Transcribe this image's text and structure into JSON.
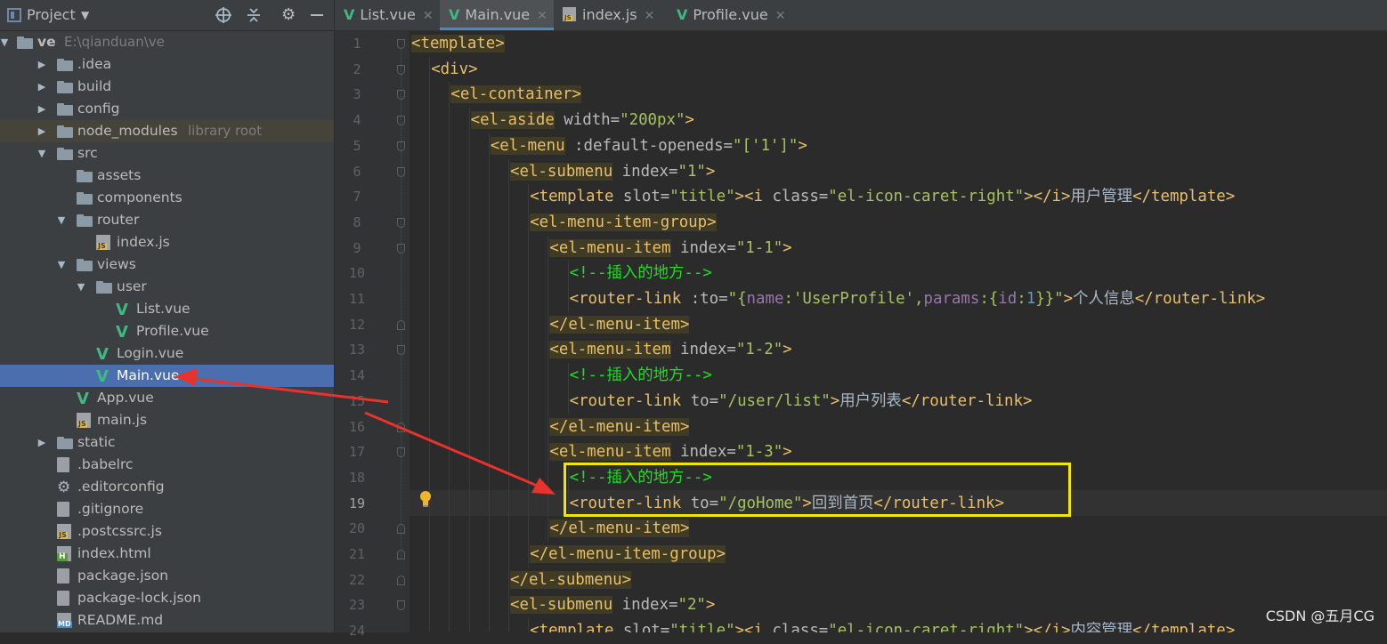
{
  "project_panel": {
    "title": "Project",
    "items": [
      {
        "label": "ve",
        "sub": "E:\\qianduan\\ve",
        "depth": 0,
        "arrow": "down",
        "icon": "project-folder-icon"
      },
      {
        "label": ".idea",
        "depth": 1,
        "arrow": "right",
        "icon": "folder-icon"
      },
      {
        "label": "build",
        "depth": 1,
        "arrow": "right",
        "icon": "folder-icon"
      },
      {
        "label": "config",
        "depth": 1,
        "arrow": "right",
        "icon": "folder-icon"
      },
      {
        "label": "node_modules",
        "sub": "library root",
        "depth": 1,
        "arrow": "right",
        "icon": "folder-icon",
        "state": "libroot"
      },
      {
        "label": "src",
        "depth": 1,
        "arrow": "down",
        "icon": "folder-icon"
      },
      {
        "label": "assets",
        "depth": 2,
        "arrow": "",
        "icon": "folder-icon"
      },
      {
        "label": "components",
        "depth": 2,
        "arrow": "",
        "icon": "folder-icon"
      },
      {
        "label": "router",
        "depth": 2,
        "arrow": "down",
        "icon": "folder-icon"
      },
      {
        "label": "index.js",
        "depth": 3,
        "arrow": "",
        "icon": "js-file-icon"
      },
      {
        "label": "views",
        "depth": 2,
        "arrow": "down",
        "icon": "folder-icon"
      },
      {
        "label": "user",
        "depth": 3,
        "arrow": "down",
        "icon": "folder-icon"
      },
      {
        "label": "List.vue",
        "depth": 4,
        "arrow": "",
        "icon": "vue-file-icon"
      },
      {
        "label": "Profile.vue",
        "depth": 4,
        "arrow": "",
        "icon": "vue-file-icon"
      },
      {
        "label": "Login.vue",
        "depth": 3,
        "arrow": "",
        "icon": "vue-file-icon"
      },
      {
        "label": "Main.vue",
        "depth": 3,
        "arrow": "",
        "icon": "vue-file-icon",
        "state": "selected"
      },
      {
        "label": "App.vue",
        "depth": 2,
        "arrow": "",
        "icon": "vue-file-icon"
      },
      {
        "label": "main.js",
        "depth": 2,
        "arrow": "",
        "icon": "js-file-icon"
      },
      {
        "label": "static",
        "depth": 1,
        "arrow": "right",
        "icon": "folder-icon"
      },
      {
        "label": ".babelrc",
        "depth": 1,
        "arrow": "",
        "icon": "config-file-icon"
      },
      {
        "label": ".editorconfig",
        "depth": 1,
        "arrow": "",
        "icon": "gear-icon"
      },
      {
        "label": ".gitignore",
        "depth": 1,
        "arrow": "",
        "icon": "config-file-icon"
      },
      {
        "label": ".postcssrc.js",
        "depth": 1,
        "arrow": "",
        "icon": "js-file-icon"
      },
      {
        "label": "index.html",
        "depth": 1,
        "arrow": "",
        "icon": "html-file-icon"
      },
      {
        "label": "package.json",
        "depth": 1,
        "arrow": "",
        "icon": "config-file-icon"
      },
      {
        "label": "package-lock.json",
        "depth": 1,
        "arrow": "",
        "icon": "config-file-icon"
      },
      {
        "label": "README.md",
        "depth": 1,
        "arrow": "",
        "icon": "md-file-icon"
      }
    ]
  },
  "tabs": [
    {
      "label": "List.vue",
      "icon": "vue-file-icon",
      "active": false
    },
    {
      "label": "Main.vue",
      "icon": "vue-file-icon",
      "active": true
    },
    {
      "label": "index.js",
      "icon": "js-file-icon",
      "active": false
    },
    {
      "label": "Profile.vue",
      "icon": "vue-file-icon",
      "active": false
    }
  ],
  "editor": {
    "current_line": 19,
    "lines": [
      {
        "n": "1",
        "indent": 0,
        "tokens": [
          [
            "tbg",
            "<template>"
          ]
        ]
      },
      {
        "n": "2",
        "indent": 1,
        "tokens": [
          [
            "t",
            "<div>"
          ]
        ]
      },
      {
        "n": "3",
        "indent": 2,
        "tokens": [
          [
            "tbg",
            "<el-container>"
          ]
        ]
      },
      {
        "n": "4",
        "indent": 3,
        "tokens": [
          [
            "tbg",
            "<el-aside"
          ],
          [
            "at",
            " width="
          ],
          [
            "v",
            "\"200px\""
          ],
          [
            "t",
            ">"
          ]
        ]
      },
      {
        "n": "5",
        "indent": 4,
        "tokens": [
          [
            "tbg",
            "<el-menu"
          ],
          [
            "at",
            " :default-openeds="
          ],
          [
            "v",
            "\"["
          ],
          [
            "v",
            "'1'"
          ],
          [
            "v",
            "]\""
          ],
          [
            "t",
            ">"
          ]
        ]
      },
      {
        "n": "6",
        "indent": 5,
        "tokens": [
          [
            "tbg",
            "<el-submenu"
          ],
          [
            "at",
            " index="
          ],
          [
            "v",
            "\"1\""
          ],
          [
            "t",
            ">"
          ]
        ]
      },
      {
        "n": "7",
        "indent": 6,
        "tokens": [
          [
            "t",
            "<template"
          ],
          [
            "at",
            " slot="
          ],
          [
            "v",
            "\"title\""
          ],
          [
            "t",
            "><i"
          ],
          [
            "at",
            " class="
          ],
          [
            "v",
            "\"el-icon-caret-right\""
          ],
          [
            "t",
            "></i>"
          ],
          [
            "tx",
            "用户管理"
          ],
          [
            "t",
            "</template>"
          ]
        ]
      },
      {
        "n": "8",
        "indent": 6,
        "tokens": [
          [
            "tbg",
            "<el-menu-item-group>"
          ]
        ]
      },
      {
        "n": "9",
        "indent": 7,
        "tokens": [
          [
            "tbg",
            "<el-menu-item"
          ],
          [
            "at",
            " index="
          ],
          [
            "v",
            "\"1-1\""
          ],
          [
            "t",
            ">"
          ]
        ]
      },
      {
        "n": "10",
        "indent": 8,
        "tokens": [
          [
            "cm",
            "<!--插入的地方-->"
          ]
        ]
      },
      {
        "n": "11",
        "indent": 8,
        "tokens": [
          [
            "t",
            "<router-link"
          ],
          [
            "at",
            " :to="
          ],
          [
            "v",
            "\"{"
          ],
          [
            "nm",
            "name"
          ],
          [
            "v",
            ":'UserProfile',"
          ],
          [
            "nm",
            "params"
          ],
          [
            "v",
            ":{"
          ],
          [
            "nm",
            "id"
          ],
          [
            "v",
            ":"
          ],
          [
            "nv",
            "1"
          ],
          [
            "v",
            "}}\""
          ],
          [
            "t",
            ">"
          ],
          [
            "tx",
            "个人信息"
          ],
          [
            "t",
            "</router-link>"
          ]
        ]
      },
      {
        "n": "12",
        "indent": 7,
        "tokens": [
          [
            "tbg",
            "</el-menu-item>"
          ]
        ]
      },
      {
        "n": "13",
        "indent": 7,
        "tokens": [
          [
            "tbg",
            "<el-menu-item"
          ],
          [
            "at",
            " index="
          ],
          [
            "v",
            "\"1-2\""
          ],
          [
            "t",
            ">"
          ]
        ]
      },
      {
        "n": "14",
        "indent": 8,
        "tokens": [
          [
            "cm",
            "<!--插入的地方-->"
          ]
        ]
      },
      {
        "n": "15",
        "indent": 8,
        "tokens": [
          [
            "t",
            "<router-link"
          ],
          [
            "at",
            " to="
          ],
          [
            "v",
            "\"/user/list\""
          ],
          [
            "t",
            ">"
          ],
          [
            "tx",
            "用户列表"
          ],
          [
            "t",
            "</router-link>"
          ]
        ]
      },
      {
        "n": "16",
        "indent": 7,
        "tokens": [
          [
            "tbg",
            "</el-menu-item>"
          ]
        ]
      },
      {
        "n": "17",
        "indent": 7,
        "tokens": [
          [
            "tbg",
            "<el-menu-item"
          ],
          [
            "at",
            " index="
          ],
          [
            "v",
            "\"1-3\""
          ],
          [
            "t",
            ">"
          ]
        ]
      },
      {
        "n": "18",
        "indent": 8,
        "tokens": [
          [
            "cm",
            "<!--插入的地方-->"
          ]
        ]
      },
      {
        "n": "19",
        "indent": 8,
        "tokens": [
          [
            "t",
            "<router-link"
          ],
          [
            "at",
            " to="
          ],
          [
            "v",
            "\"/goHome\""
          ],
          [
            "t",
            ">"
          ],
          [
            "tx",
            "回到首页"
          ],
          [
            "t",
            "</router-link>"
          ]
        ]
      },
      {
        "n": "20",
        "indent": 7,
        "tokens": [
          [
            "tbg",
            "</el-menu-item>"
          ]
        ]
      },
      {
        "n": "21",
        "indent": 6,
        "tokens": [
          [
            "tbg",
            "</el-menu-item-group>"
          ]
        ]
      },
      {
        "n": "22",
        "indent": 5,
        "tokens": [
          [
            "tbg",
            "</el-submenu>"
          ]
        ]
      },
      {
        "n": "23",
        "indent": 5,
        "tokens": [
          [
            "tbg",
            "<el-submenu"
          ],
          [
            "at",
            " index="
          ],
          [
            "v",
            "\"2\""
          ],
          [
            "t",
            ">"
          ]
        ]
      },
      {
        "n": "24",
        "indent": 6,
        "tokens": [
          [
            "t",
            "<template"
          ],
          [
            "at",
            " slot="
          ],
          [
            "v",
            "\"title\""
          ],
          [
            "t",
            "><i"
          ],
          [
            "at",
            " class="
          ],
          [
            "v",
            "\"el-icon-caret-right\""
          ],
          [
            "t",
            "></i>"
          ],
          [
            "tx",
            "内容管理"
          ],
          [
            "t",
            "</template>"
          ]
        ]
      }
    ]
  },
  "colors": {
    "highlight_box": "#f2e500",
    "annotation_arrow": "#e8322c",
    "selection": "#4b6eaf"
  },
  "watermark": "CSDN @五月CG"
}
